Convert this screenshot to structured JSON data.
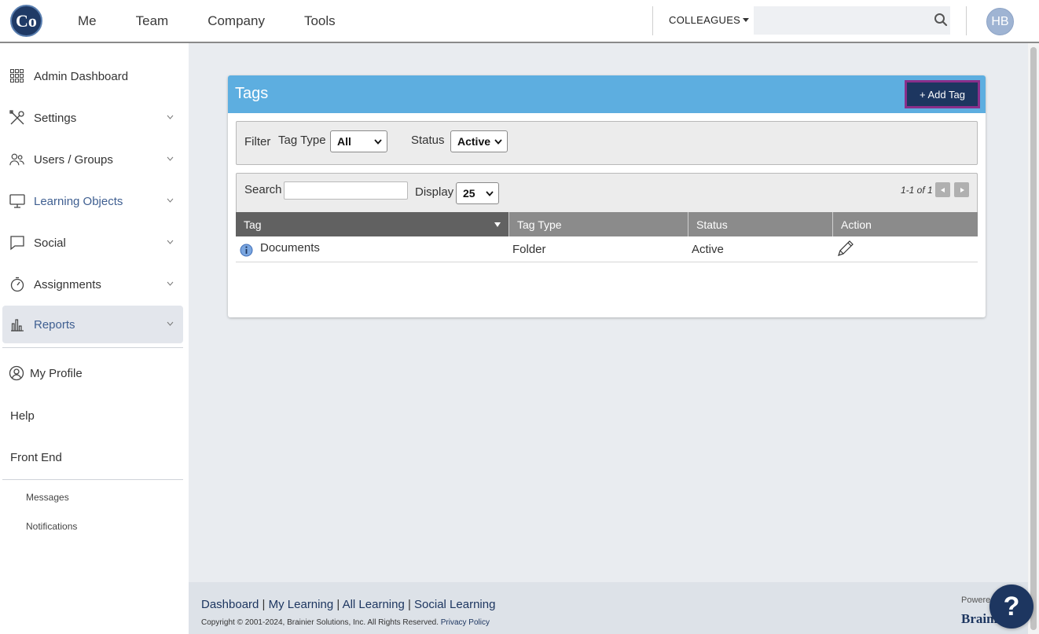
{
  "topbar": {
    "logo_text": "Co",
    "nav": [
      "Me",
      "Team",
      "Company",
      "Tools"
    ],
    "colleagues_label": "COLLEAGUES",
    "search_placeholder": "",
    "avatar_initials": "HB"
  },
  "sidebar": {
    "items": [
      {
        "label": "Admin Dashboard",
        "icon": "grid-icon"
      },
      {
        "label": "Settings",
        "icon": "tools-icon"
      },
      {
        "label": "Users / Groups",
        "icon": "users-icon"
      },
      {
        "label": "Learning Objects",
        "icon": "monitor-icon"
      },
      {
        "label": "Social",
        "icon": "chat-icon"
      },
      {
        "label": "Assignments",
        "icon": "stopwatch-icon"
      },
      {
        "label": "Reports",
        "icon": "bar-chart-icon"
      }
    ],
    "my_profile": "My Profile",
    "help": "Help",
    "front_end": "Front End",
    "messages": "Messages",
    "notifications": "Notifications"
  },
  "panel": {
    "title": "Tags",
    "add_button": "+ Add Tag",
    "filter": {
      "filter_label": "Filter",
      "tag_type_label": "Tag Type",
      "tag_type_value": "All",
      "status_label": "Status",
      "status_value": "Active"
    },
    "grid": {
      "search_label": "Search",
      "search_value": "",
      "display_label": "Display",
      "display_value": "25",
      "pager_text": "1-1 of 1"
    },
    "columns": [
      "Tag",
      "Tag Type",
      "Status",
      "Action"
    ],
    "rows": [
      {
        "tag": "Documents",
        "tag_type": "Folder",
        "status": "Active"
      }
    ]
  },
  "footer": {
    "links": [
      "Dashboard",
      "My Learning",
      "All Learning",
      "Social Learning"
    ],
    "copyright": "Copyright © 2001-2024, Brainier Solutions, Inc. All Rights Reserved.",
    "privacy": "Privacy Policy",
    "powered": "Powered",
    "brand": "Braini"
  },
  "help_fab": "?",
  "colors": {
    "header_blue": "#5daee0",
    "brand_navy": "#1d3660",
    "highlight_purple": "#8a2f8a"
  }
}
